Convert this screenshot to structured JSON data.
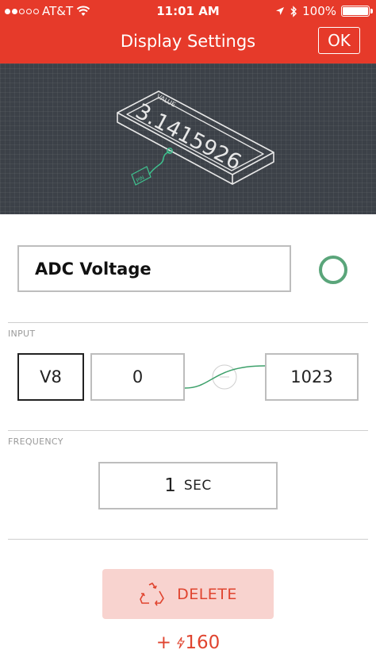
{
  "status_bar": {
    "carrier": "AT&T",
    "time": "11:01 AM",
    "battery_percent": "100%",
    "battery_level": 1.0,
    "icons": [
      "signal-dots",
      "wifi-icon",
      "location-arrow-icon",
      "bluetooth-icon",
      "battery-icon"
    ]
  },
  "nav": {
    "title": "Display Settings",
    "ok_label": "OK"
  },
  "preview": {
    "value_label": "VALUE",
    "value_text": "3.1415926",
    "pin_label": "PIN"
  },
  "widget": {
    "name": "ADC Voltage",
    "color": "#5aa57a"
  },
  "input": {
    "section_label": "INPUT",
    "pin": "V8",
    "min": "0",
    "max": "1023"
  },
  "frequency": {
    "section_label": "FREQUENCY",
    "value": "1",
    "unit": "SEC"
  },
  "delete": {
    "label": "DELETE",
    "icon": "recycle-icon"
  },
  "energy": {
    "text": "+ ",
    "amount": "160",
    "icon": "lightning-icon"
  },
  "colors": {
    "brand_red": "#e63a2a",
    "preview_bg": "#3c4148",
    "delete_bg": "#f8d3cf",
    "delete_text": "#e0442f",
    "accent_green": "#5aa57a"
  }
}
